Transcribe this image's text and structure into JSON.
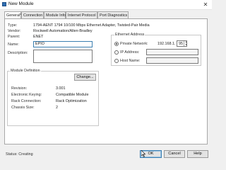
{
  "window": {
    "title": "New Module",
    "close_glyph": "✕"
  },
  "tabs": [
    {
      "label": "General*",
      "active": true
    },
    {
      "label": "Connection"
    },
    {
      "label": "Module Info"
    },
    {
      "label": "Internet Protocol"
    },
    {
      "label": "Port Diagnostics"
    }
  ],
  "general": {
    "type_label": "Type:",
    "type_value": "1794-AENT 1794 10/100 Mbps Ethernet Adapter, Twisted-Pair Media",
    "vendor_label": "Vendor:",
    "vendor_value": "Rockwell Automation/Allen-Bradley",
    "parent_label": "Parent:",
    "parent_value": "ENET",
    "name_label": "Name:",
    "name_value": "EPIO",
    "description_label": "Description:",
    "description_value": ""
  },
  "ethernet_address": {
    "title": "Ethernet Address",
    "private_network_label": "Private Network:",
    "private_network_prefix": "192.168.1.",
    "private_network_octet": "95",
    "ip_address_label": "IP Address:",
    "host_name_label": "Host Name:",
    "selected": "private_network"
  },
  "module_definition": {
    "title": "Module Definition",
    "change_button": "Change...",
    "revision_label": "Revision:",
    "revision_value": "3.001",
    "keying_label": "Electronic Keying:",
    "keying_value": "Compatible Module",
    "rack_connection_label": "Rack Connection:",
    "rack_connection_value": "Rack Optimization",
    "chassis_size_label": "Chassis Size:",
    "chassis_size_value": "2"
  },
  "status": {
    "text": "Status: Creating"
  },
  "buttons": {
    "ok": "OK",
    "cancel": "Cancel",
    "help": "Help"
  },
  "colors": {
    "accent": "#3c7fb1",
    "panel_bg": "#ffffff",
    "window_bg": "#f0f0f0"
  }
}
